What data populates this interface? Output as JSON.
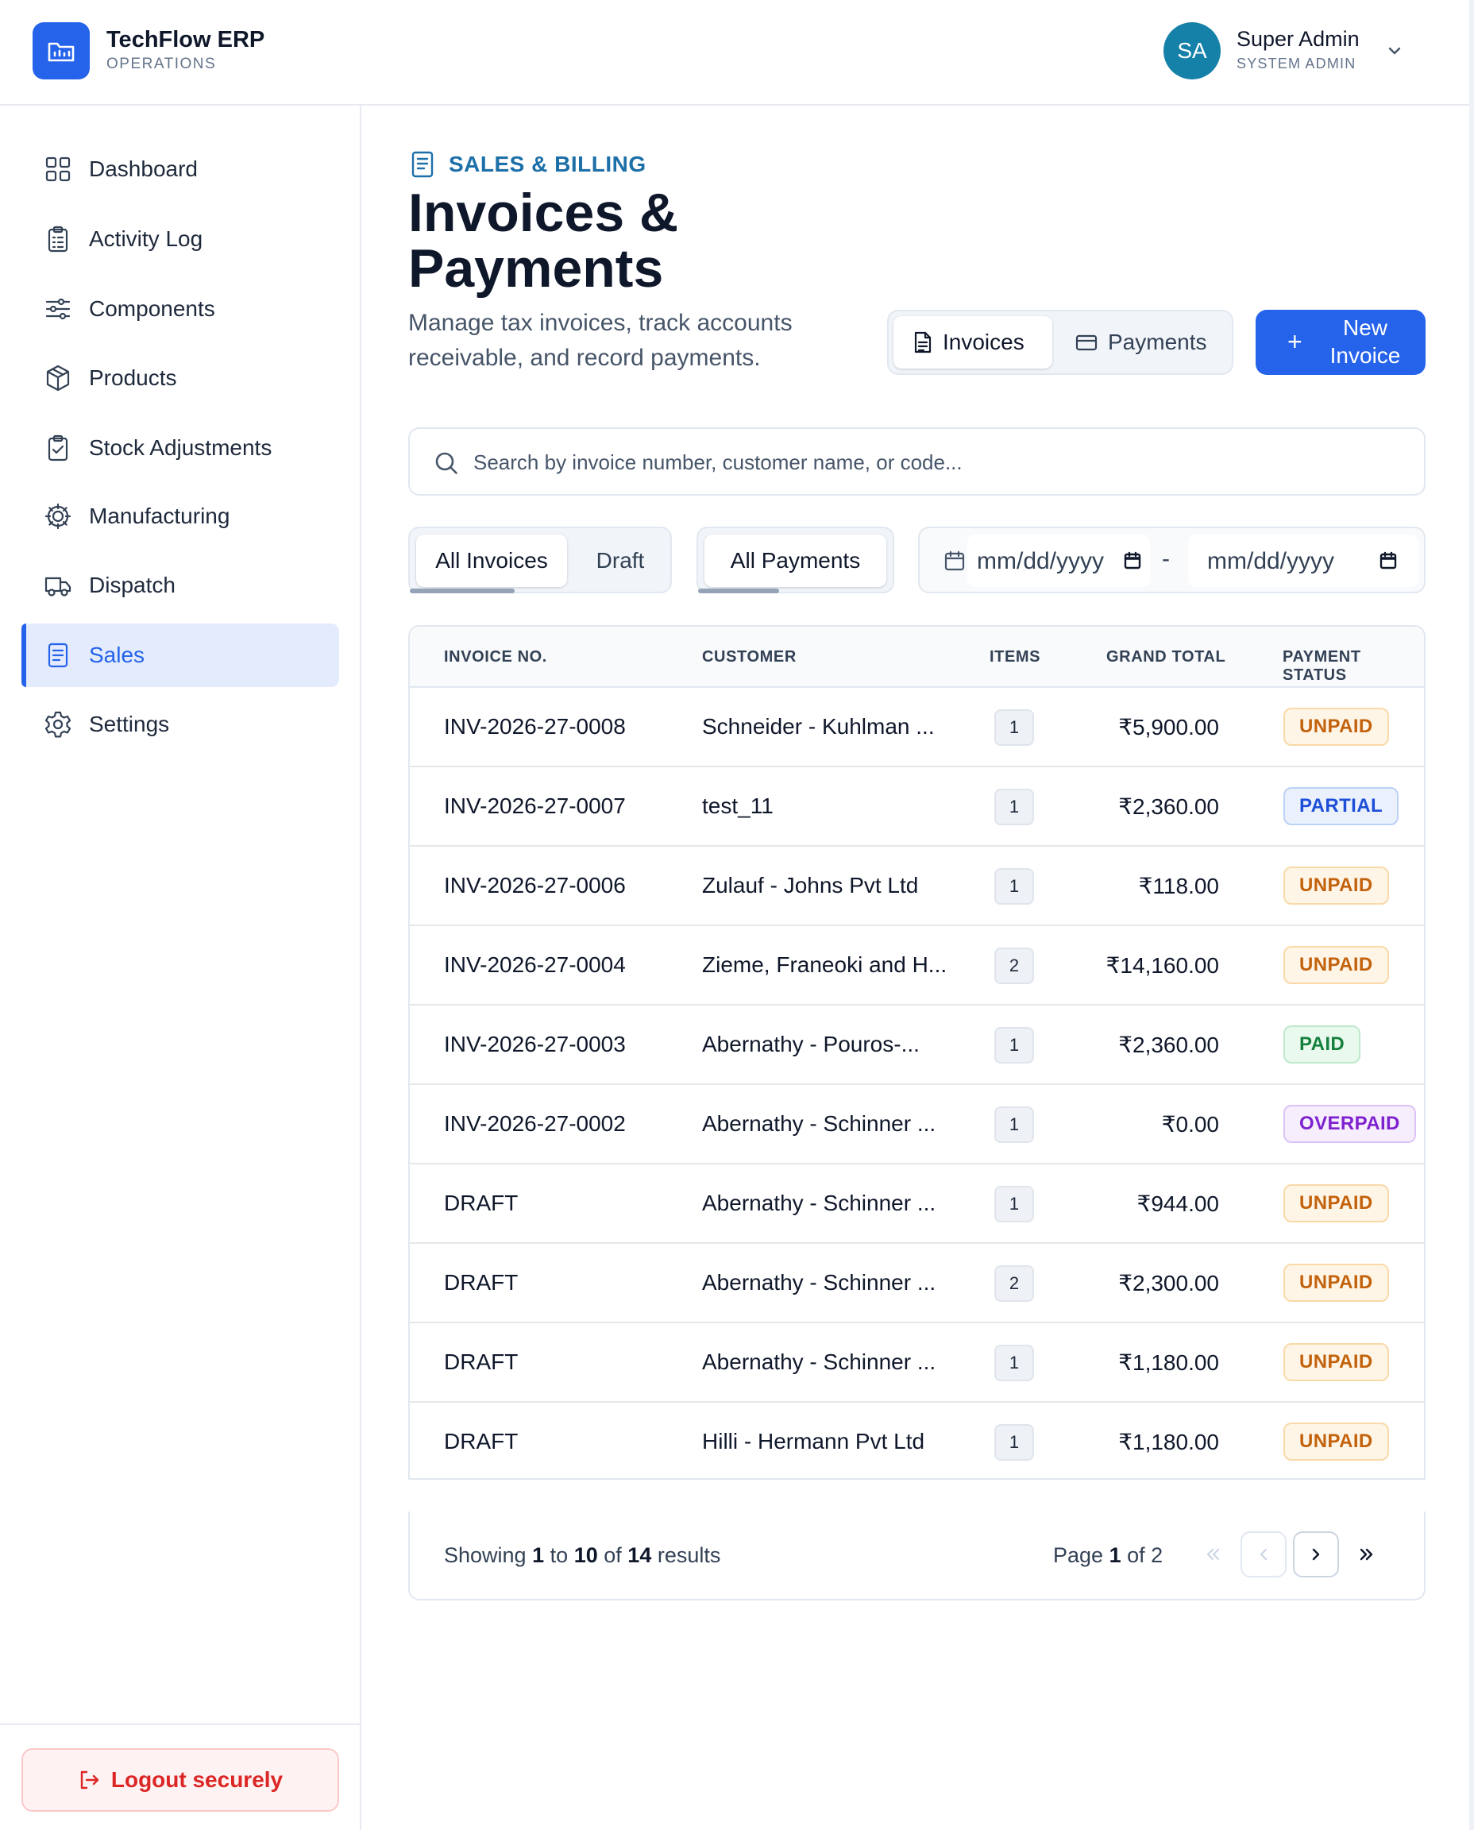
{
  "app": {
    "name": "TechFlow ERP",
    "subtitle": "OPERATIONS"
  },
  "user": {
    "initials": "SA",
    "name": "Super Admin",
    "role": "SYSTEM ADMIN",
    "avatar_color": "#1581a9"
  },
  "sidebar": {
    "items": [
      {
        "label": "Dashboard",
        "icon": "grid-icon"
      },
      {
        "label": "Activity Log",
        "icon": "clipboard-list-icon"
      },
      {
        "label": "Components",
        "icon": "sliders-icon"
      },
      {
        "label": "Products",
        "icon": "package-icon"
      },
      {
        "label": "Stock Adjustments",
        "icon": "clipboard-check-icon"
      },
      {
        "label": "Manufacturing",
        "icon": "cog-icon"
      },
      {
        "label": "Dispatch",
        "icon": "truck-icon"
      },
      {
        "label": "Sales",
        "icon": "document-icon",
        "active": true
      },
      {
        "label": "Settings",
        "icon": "settings-icon"
      }
    ],
    "logout_label": "Logout securely"
  },
  "page": {
    "eyebrow": "SALES & BILLING",
    "title": "Invoices & Payments",
    "subtitle": "Manage tax invoices, track accounts receivable, and record payments."
  },
  "view_toggle": {
    "invoices_label": "Invoices",
    "payments_label": "Payments",
    "selected": "Invoices"
  },
  "new_invoice_label": "New Invoice",
  "search": {
    "placeholder": "Search by invoice number, customer name, or code...",
    "value": ""
  },
  "filters": {
    "invoice_tabs": [
      "All Invoices",
      "Draft"
    ],
    "invoice_selected": "All Invoices",
    "payment_tabs": [
      "All Payments"
    ],
    "payment_selected": "All Payments",
    "date_from_placeholder": "mm/dd/yyyy",
    "date_to_placeholder": "mm/dd/yyyy",
    "date_separator": "-"
  },
  "table": {
    "columns": [
      "INVOICE NO.",
      "CUSTOMER",
      "ITEMS",
      "GRAND TOTAL",
      "PAYMENT STATUS"
    ],
    "rows": [
      {
        "invoice_no": "INV-2026-27-0008",
        "customer": "Schneider - Kuhlman ...",
        "items": "1",
        "total": "₹5,900.00",
        "status": "UNPAID"
      },
      {
        "invoice_no": "INV-2026-27-0007",
        "customer": "test_11",
        "items": "1",
        "total": "₹2,360.00",
        "status": "PARTIAL"
      },
      {
        "invoice_no": "INV-2026-27-0006",
        "customer": "Zulauf - Johns Pvt Ltd",
        "items": "1",
        "total": "₹118.00",
        "status": "UNPAID"
      },
      {
        "invoice_no": "INV-2026-27-0004",
        "customer": "Zieme, Franeoki and H...",
        "items": "2",
        "total": "₹14,160.00",
        "status": "UNPAID"
      },
      {
        "invoice_no": "INV-2026-27-0003",
        "customer": "Abernathy - Pouros-...",
        "items": "1",
        "total": "₹2,360.00",
        "status": "PAID"
      },
      {
        "invoice_no": "INV-2026-27-0002",
        "customer": "Abernathy - Schinner ...",
        "items": "1",
        "total": "₹0.00",
        "status": "OVERPAID"
      },
      {
        "invoice_no": "DRAFT",
        "customer": "Abernathy - Schinner ...",
        "items": "1",
        "total": "₹944.00",
        "status": "UNPAID"
      },
      {
        "invoice_no": "DRAFT",
        "customer": "Abernathy - Schinner ...",
        "items": "2",
        "total": "₹2,300.00",
        "status": "UNPAID"
      },
      {
        "invoice_no": "DRAFT",
        "customer": "Abernathy - Schinner ...",
        "items": "1",
        "total": "₹1,180.00",
        "status": "UNPAID"
      },
      {
        "invoice_no": "DRAFT",
        "customer": "Hilli - Hermann Pvt Ltd",
        "items": "1",
        "total": "₹1,180.00",
        "status": "UNPAID"
      }
    ]
  },
  "status_colors": {
    "UNPAID": {
      "bg": "#fff5e6",
      "border": "#f9d9a8",
      "text": "#c2620c"
    },
    "PARTIAL": {
      "bg": "#eaf1fd",
      "border": "#bcd2f7",
      "text": "#1d4ed8"
    },
    "PAID": {
      "bg": "#e9f9ee",
      "border": "#bfe8cc",
      "text": "#15803d"
    },
    "OVERPAID": {
      "bg": "#f6edfd",
      "border": "#dcc3f6",
      "text": "#7e22ce"
    }
  },
  "pagination": {
    "showing_prefix": "Showing",
    "from": "1",
    "to_word": "to",
    "to": "10",
    "of_word": "of",
    "total": "14",
    "results_word": "results",
    "page_word": "Page",
    "current_page": "1",
    "page_count": "2"
  },
  "colors": {
    "accent": "#2563eb",
    "eyebrow": "#1d6fa8",
    "logout": "#dc2626"
  }
}
